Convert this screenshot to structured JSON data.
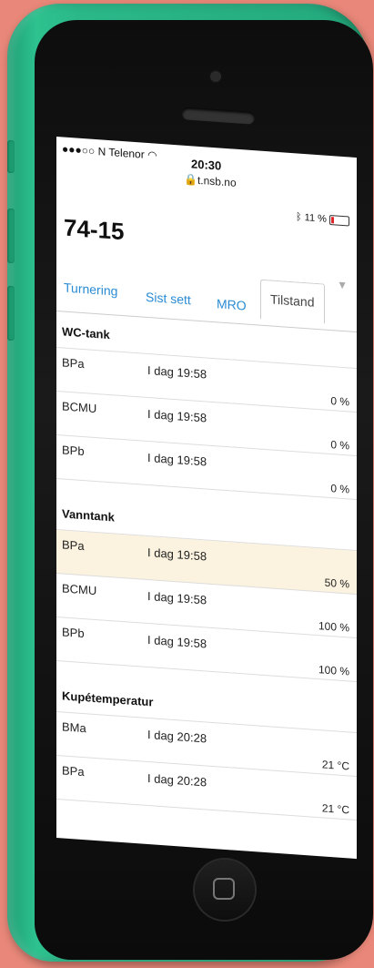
{
  "status_bar": {
    "carrier": "●●●○○ N Telenor",
    "wifi_icon": "wifi-icon",
    "time": "20:30",
    "url": "t.nsb.no",
    "bluetooth_icon": "bluetooth-icon",
    "battery": "11 %",
    "battery_color": "#e0252b"
  },
  "header": {
    "title": "74-15",
    "dropdown_glyph": "▼"
  },
  "tabs": [
    {
      "label": "Turnering"
    },
    {
      "label": "Sist sett"
    },
    {
      "label": "MRO"
    },
    {
      "label": "Tilstand"
    }
  ],
  "sections": [
    {
      "title": "WC-tank",
      "rows": [
        {
          "name": "BPa",
          "date": "I dag 19:58",
          "value": "0 %"
        },
        {
          "name": "BCMU",
          "date": "I dag 19:58",
          "value": "0 %"
        },
        {
          "name": "BPb",
          "date": "I dag 19:58",
          "value": "0 %"
        }
      ]
    },
    {
      "title": "Vanntank",
      "rows": [
        {
          "name": "BPa",
          "date": "I dag 19:58",
          "value": "50 %"
        },
        {
          "name": "BCMU",
          "date": "I dag 19:58",
          "value": "100 %"
        },
        {
          "name": "BPb",
          "date": "I dag 19:58",
          "value": "100 %"
        }
      ]
    },
    {
      "title": "Kupétemperatur",
      "rows": [
        {
          "name": "BMa",
          "date": "I dag 20:28",
          "value": "21 °C"
        },
        {
          "name": "BPa",
          "date": "I dag 20:28",
          "value": "21 °C"
        }
      ]
    }
  ],
  "colors": {
    "link": "#2a8bd3",
    "highlight_row": "#fbf3df",
    "phone_body": "#2bb889",
    "background": "#e9887a"
  }
}
